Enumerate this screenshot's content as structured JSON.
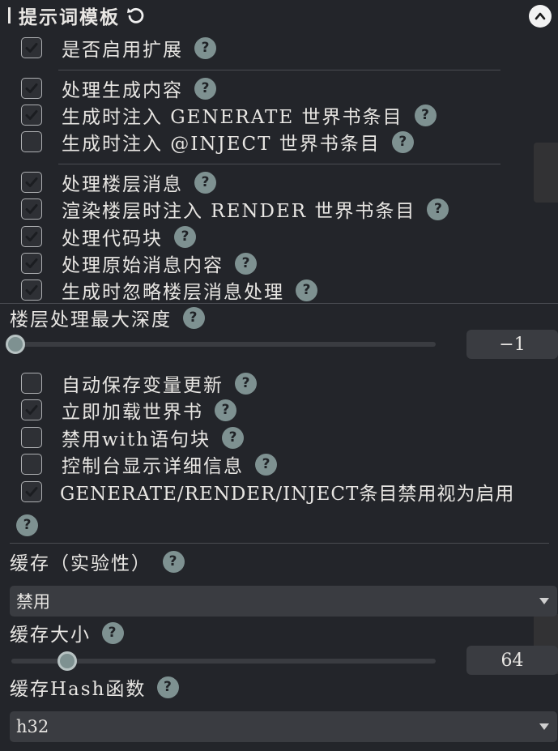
{
  "panel": {
    "title": "提示词模板",
    "options": {
      "enable_extension": {
        "label": "是否启用扩展",
        "checked": true
      },
      "process_generate": {
        "label": "处理生成内容",
        "checked": true
      },
      "inject_generate": {
        "label": "生成时注入 GENERATE 世界书条目",
        "checked": true
      },
      "inject_inject": {
        "label": "生成时注入 @INJECT 世界书条目",
        "checked": false
      },
      "process_floor": {
        "label": "处理楼层消息",
        "checked": true
      },
      "render_inject": {
        "label": "渲染楼层时注入 RENDER 世界书条目",
        "checked": true
      },
      "process_codeblock": {
        "label": "处理代码块",
        "checked": true
      },
      "process_raw": {
        "label": "处理原始消息内容",
        "checked": true
      },
      "ignore_floor_on_gen": {
        "label": "生成时忽略楼层消息处理",
        "checked": true
      },
      "autosave_vars": {
        "label": "自动保存变量更新",
        "checked": false
      },
      "load_worldbook": {
        "label": "立即加载世界书",
        "checked": true
      },
      "disable_with": {
        "label": "禁用with语句块",
        "checked": false
      },
      "console_verbose": {
        "label": "控制台显示详细信息",
        "checked": false
      },
      "disabled_as_enabled": {
        "label": "GENERATE/RENDER/INJECT条目禁用视为启用",
        "checked": true
      }
    },
    "max_depth": {
      "label": "楼层处理最大深度",
      "value": "−1"
    },
    "cache": {
      "label": "缓存（实验性）",
      "selected": "禁用"
    },
    "cache_size": {
      "label": "缓存大小",
      "value": "64"
    },
    "hash": {
      "label": "缓存Hash函数",
      "selected": "h32"
    },
    "help_glyph": "?",
    "colors": {
      "help_badge": "#7e9191",
      "background": "#23252a"
    }
  }
}
